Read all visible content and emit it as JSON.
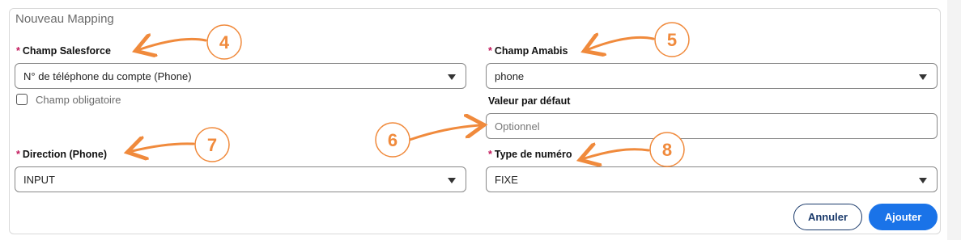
{
  "panel": {
    "title": "Nouveau Mapping"
  },
  "fields": {
    "salesforce": {
      "required_mark": "*",
      "label": "Champ Salesforce",
      "value": "N° de téléphone du compte (Phone)"
    },
    "mandatory": {
      "label": "Champ obligatoire",
      "checked": false
    },
    "amabis": {
      "required_mark": "*",
      "label": "Champ Amabis",
      "value": "phone"
    },
    "default_value": {
      "label": "Valeur par défaut",
      "placeholder": "Optionnel",
      "value": ""
    },
    "direction": {
      "required_mark": "*",
      "label": "Direction (Phone)",
      "value": "INPUT"
    },
    "number_type": {
      "required_mark": "*",
      "label": "Type de numéro",
      "value": "FIXE"
    }
  },
  "actions": {
    "cancel": "Annuler",
    "add": "Ajouter"
  },
  "annotations": [
    "4",
    "5",
    "6",
    "7",
    "8"
  ],
  "colors": {
    "annotation": "#f08a3c",
    "required": "#c2185b",
    "primary_button": "#1a73e8",
    "secondary_button_border": "#1a3a6b"
  }
}
